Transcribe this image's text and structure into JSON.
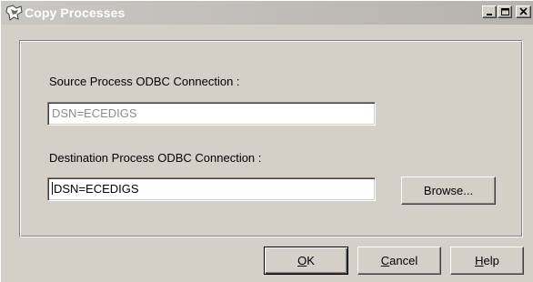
{
  "window": {
    "title": "Copy Processes",
    "minimize_glyph": "_",
    "maximize_glyph": "□",
    "close_glyph": "×"
  },
  "form": {
    "source_label": "Source Process ODBC Connection :",
    "source_value": "DSN=ECEDIGS",
    "destination_label": "Destination Process ODBC Connection :",
    "destination_value": "DSN=ECEDIGS",
    "browse_label": "Browse..."
  },
  "buttons": {
    "ok_label": "OK",
    "ok_mnemonic": "O",
    "cancel_label": "Cancel",
    "cancel_mnemonic": "C",
    "help_label": "Help",
    "help_mnemonic": "H"
  },
  "colors": {
    "dialog_background": "#d4d0c8",
    "disabled_text": "#8c8c8c",
    "title_text": "#ffffff"
  }
}
